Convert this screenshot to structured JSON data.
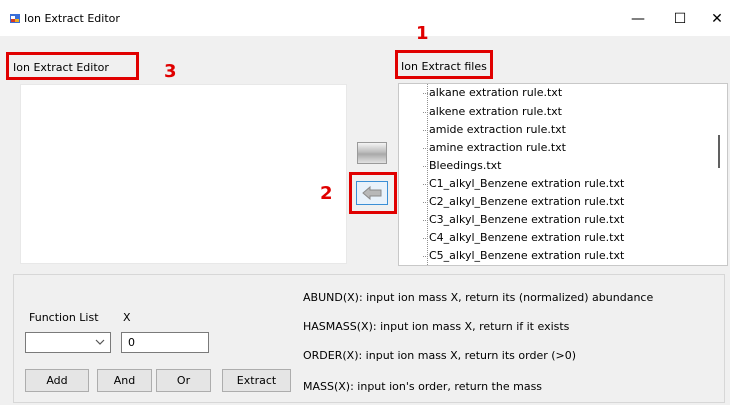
{
  "window": {
    "title": "Ion Extract Editor",
    "minimize_glyph": "—",
    "maximize_glyph": "☐",
    "close_glyph": "✕"
  },
  "labels": {
    "editor": "Ion Extract Editor",
    "files": "Ion Extract files"
  },
  "annotations": {
    "files_marker": "1",
    "arrow_marker": "2",
    "editor_marker": "3"
  },
  "files": [
    "alkane extration rule.txt",
    "alkene extration rule.txt",
    "amide extraction rule.txt",
    "amine extraction rule.txt",
    "Bleedings.txt",
    "C1_alkyl_Benzene extration rule.txt",
    "C2_alkyl_Benzene extration rule.txt",
    "C3_alkyl_Benzene extration rule.txt",
    "C4_alkyl_Benzene extration rule.txt",
    "C5_alkyl_Benzene extration rule.txt"
  ],
  "functions": {
    "function_list_label": "Function List",
    "x_label": "X",
    "x_value": "0",
    "selected_function": ""
  },
  "buttons": {
    "add": "Add",
    "and": "And",
    "or": "Or",
    "extract": "Extract"
  },
  "help": [
    "ABUND(X): input ion mass X, return its (normalized) abundance",
    "HASMASS(X): input ion mass X, return if it exists",
    "ORDER(X): input ion mass X, return its order (>0)",
    "MASS(X): input ion's order, return the mass"
  ],
  "colors": {
    "annotation_red": "#e00000",
    "selected_border": "#3b8fd6"
  },
  "icons": {
    "app": "app-window-icon",
    "transfer_top": "transfer-button-icon",
    "transfer_left": "left-arrow-icon"
  }
}
